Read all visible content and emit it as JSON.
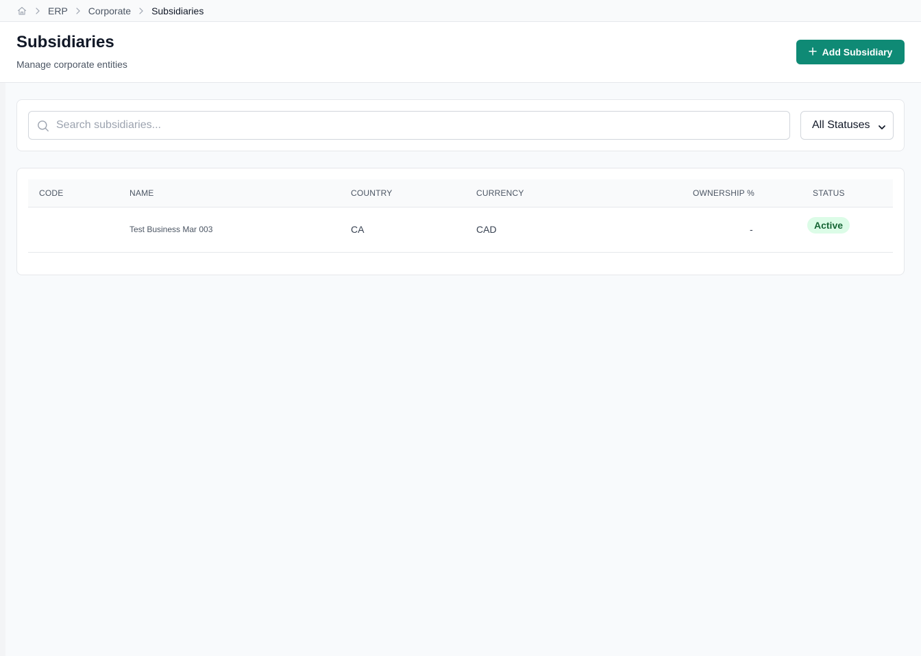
{
  "breadcrumb": {
    "items": [
      "ERP",
      "Corporate"
    ],
    "current": "Subsidiaries"
  },
  "header": {
    "title": "Subsidiaries",
    "subtitle": "Manage corporate entities",
    "add_button_label": "Add Subsidiary"
  },
  "filters": {
    "search_placeholder": "Search subsidiaries...",
    "status_selected": "All Statuses"
  },
  "table": {
    "columns": [
      "CODE",
      "NAME",
      "COUNTRY",
      "CURRENCY",
      "OWNERSHIP %",
      "STATUS"
    ],
    "rows": [
      {
        "code": "",
        "name": "Test Business Mar 003",
        "country": "CA",
        "currency": "CAD",
        "ownership": "-",
        "status": "Active"
      }
    ]
  },
  "colors": {
    "accent": "#0f8a75",
    "status_active_bg": "#dcfce7",
    "status_active_text": "#166534"
  }
}
